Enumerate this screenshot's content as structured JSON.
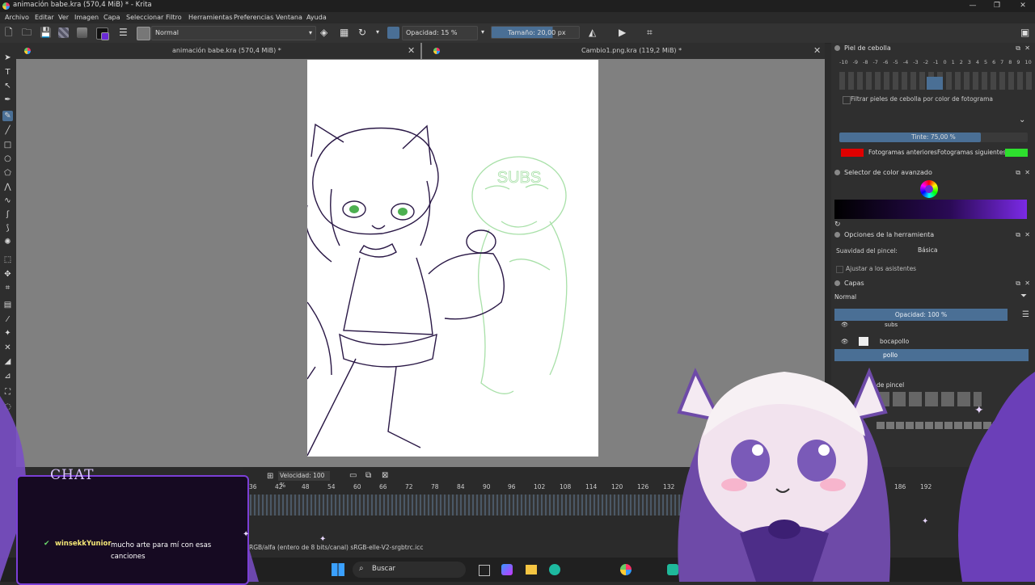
{
  "window": {
    "title": "animación babe.kra (570,4 MiB) * - Krita"
  },
  "menu": [
    "Archivo",
    "Editar",
    "Ver",
    "Imagen",
    "Capa",
    "Seleccionar",
    "Filtro",
    "Herramientas",
    "Preferencias",
    "Ventana",
    "Ayuda"
  ],
  "toolbar": {
    "blend_mode": "Normal",
    "opacity": "Opacidad: 15 %",
    "size": "Tamaño: 20,00 px"
  },
  "tabs": [
    {
      "label": "animación babe.kra (570,4 MiB) *"
    },
    {
      "label": "Cambio1.png.kra (119,2 MiB) *"
    }
  ],
  "canvas_text": "SUBS",
  "onion": {
    "title": "Piel de cebolla",
    "numbers": [
      "-10",
      "-9",
      "-8",
      "-7",
      "-6",
      "-5",
      "-4",
      "-3",
      "-2",
      "-1",
      "0",
      "1",
      "2",
      "3",
      "4",
      "5",
      "6",
      "7",
      "8",
      "9",
      "10"
    ],
    "filter_label": "Filtrar pieles de cebolla por color de fotograma",
    "tint": "Tinte: 75,00 %",
    "prev_label": "Fotogramas anteriores",
    "next_label": "Fotogramas siguientes",
    "prev_color": "#e00000",
    "next_color": "#2ee02e"
  },
  "color_selector": {
    "title": "Selector de color avanzado"
  },
  "tool_options": {
    "title": "Opciones de la herramienta",
    "smoothing_label": "Suavidad del pincel:",
    "smoothing_value": "Básica",
    "snap_label": "Ajustar a los asistentes"
  },
  "layers": {
    "title": "Capas",
    "blend": "Normal",
    "opacity": "Opacidad:  100 %",
    "items": [
      {
        "name": "subs"
      },
      {
        "name": "bocapollo"
      },
      {
        "name": "pollo"
      }
    ]
  },
  "brush_presets": {
    "label": "de pincel"
  },
  "timeline": {
    "speed": "Velocidad: 100 %",
    "frames": [
      "36",
      "42",
      "48",
      "54",
      "60",
      "66",
      "72",
      "78",
      "84",
      "90",
      "96",
      "102",
      "108",
      "114",
      "120",
      "126",
      "132",
      "186",
      "192"
    ]
  },
  "status": {
    "color_profile": "RGB/alfa (entero de 8 bits/canal)  sRGB-elle-V2-srgbtrc.icc"
  },
  "chat": {
    "title": "CHAT",
    "messages": [
      {
        "user": "winsekkYunior",
        "text": "mucho arte para mí con esas canciones"
      }
    ]
  },
  "taskbar": {
    "search_placeholder": "Buscar"
  }
}
